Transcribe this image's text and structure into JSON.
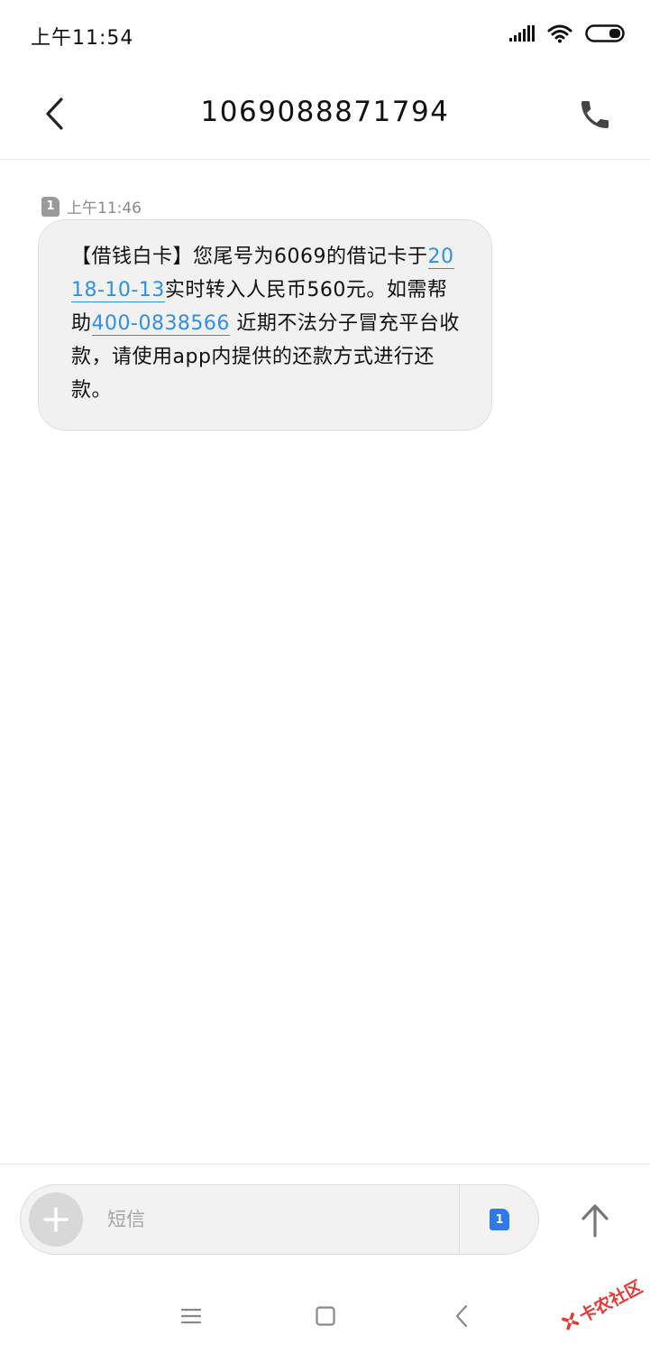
{
  "status_bar": {
    "time": "上午11:54"
  },
  "header": {
    "title": "1069088871794"
  },
  "message": {
    "sim_slot": "1",
    "time": "上午11:46",
    "text_part1": "【借钱白卡】您尾号为6069的借记卡于",
    "link_date": "2018-10-13",
    "text_part2": "实时转入人民币560元。如需帮助",
    "link_phone": "400-0838566",
    "text_part3": " 近期不法分子冒充平台收款，请使用app内提供的还款方式进行还款。"
  },
  "input": {
    "placeholder": "短信",
    "value": "",
    "sim_slot": "1"
  },
  "watermark": {
    "text": "卡农社区"
  },
  "colors": {
    "link": "#2f8fe6",
    "bubble": "#f1f1f1",
    "sim_active": "#2f7ae8",
    "watermark": "#e53935"
  },
  "icons": {
    "back": "chevron-left-icon",
    "call": "phone-icon",
    "add": "plus-icon",
    "send": "arrow-up-icon",
    "nav_menu": "menu-icon",
    "nav_home": "square-icon",
    "nav_back": "chevron-left-icon"
  }
}
